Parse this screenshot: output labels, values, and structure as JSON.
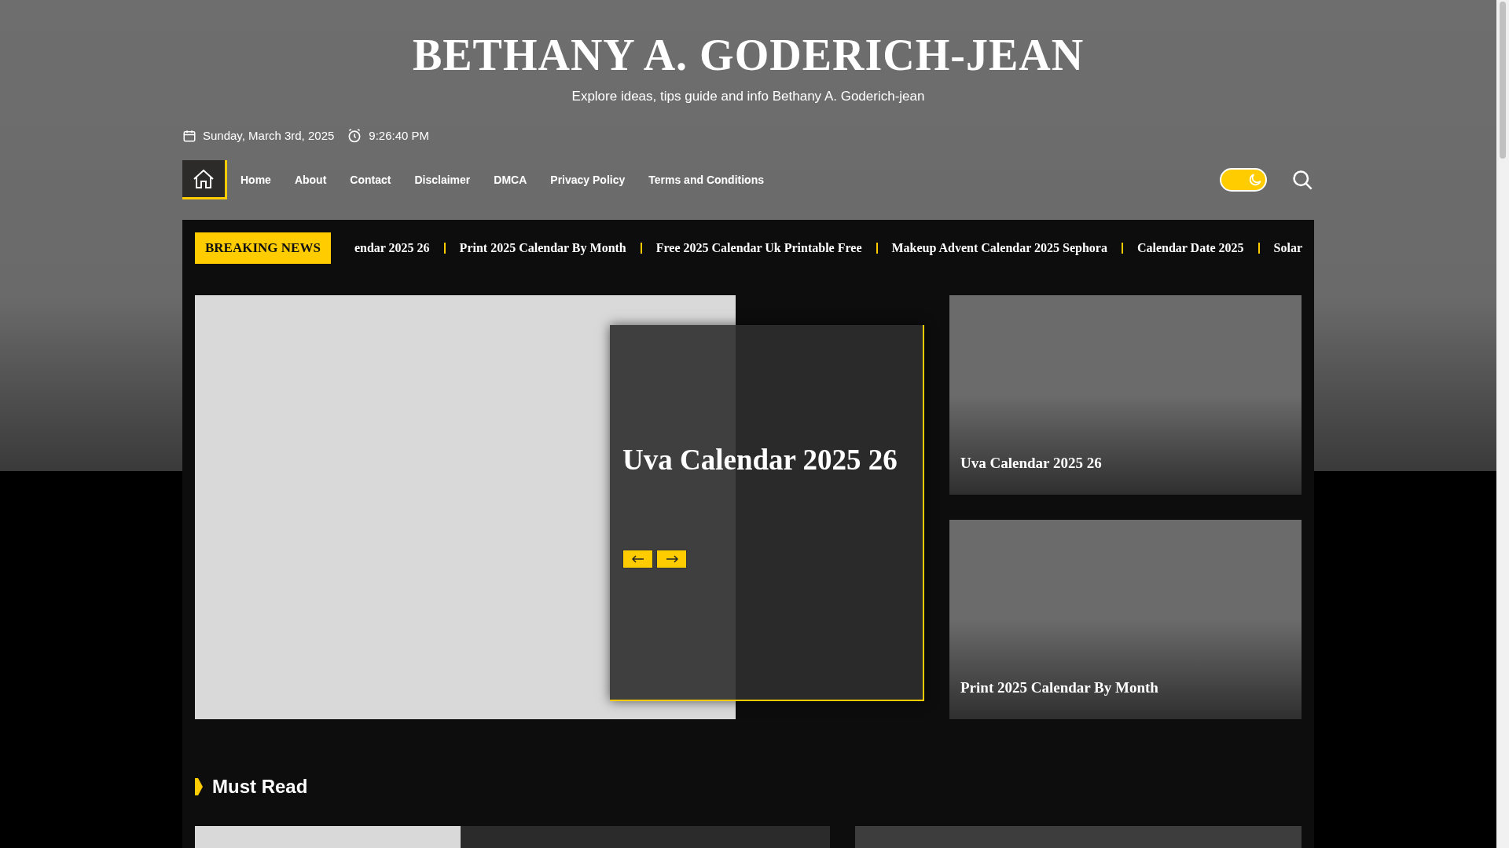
{
  "site": {
    "title": "BETHANY A. GODERICH-JEAN",
    "tagline": "Explore ideas, tips guide and info Bethany A. Goderich-jean"
  },
  "date_bar": {
    "date": "Sunday, March 3rd, 2025",
    "time": "9:26:40 PM"
  },
  "nav": {
    "items": [
      {
        "label": "Home",
        "selected": false
      },
      {
        "label": "About",
        "selected": false
      },
      {
        "label": "Contact",
        "selected": false
      },
      {
        "label": "Disclaimer",
        "selected": false
      },
      {
        "label": "DMCA",
        "selected": false
      },
      {
        "label": "Privacy Policy",
        "selected": false
      },
      {
        "label": "Terms and Conditions",
        "selected": false
      }
    ],
    "dark_mode": {
      "on": false
    }
  },
  "breaking_news": {
    "label": "BREAKING NEWS",
    "items": [
      "endar 2025 26",
      "Print 2025 Calendar By Month",
      "Free 2025 Calendar Uk Printable Free",
      "Makeup Advent Calendar 2025 Sephora",
      "Calendar Date 2025",
      "Solar"
    ]
  },
  "slider": {
    "title": "Uva Calendar 2025 26"
  },
  "side_posts": [
    {
      "title": "Uva Calendar 2025 26"
    },
    {
      "title": "Print 2025 Calendar By Month"
    }
  ],
  "must_read": {
    "heading": "Must Read"
  }
}
